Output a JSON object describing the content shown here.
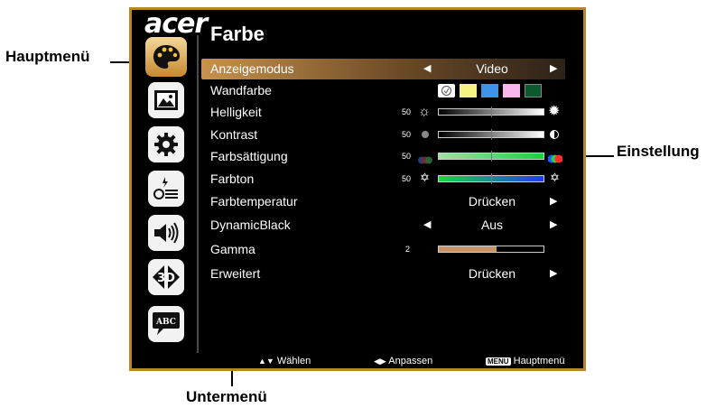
{
  "callouts": {
    "main_menu": "Hauptmenü",
    "setting": "Einstellung",
    "submenu": "Untermenü"
  },
  "brand": "acer",
  "menu": {
    "title": "Farbe",
    "rows": [
      {
        "label": "Anzeigemodus",
        "value": "Video"
      },
      {
        "label": "Wandfarbe"
      },
      {
        "label": "Helligkeit",
        "value": "50",
        "level": 0.5
      },
      {
        "label": "Kontrast",
        "value": "50",
        "level": 0.5
      },
      {
        "label": "Farbsättigung",
        "value": "50",
        "level": 0.5
      },
      {
        "label": "Farbton",
        "value": "50",
        "level": 0.5
      },
      {
        "label": "Farbtemperatur",
        "value": "Drücken"
      },
      {
        "label": "DynamicBlack",
        "value": "Aus"
      },
      {
        "label": "Gamma",
        "value": "2",
        "level": 0.55
      },
      {
        "label": "Erweitert",
        "value": "Drücken"
      }
    ],
    "wall_colors": [
      "#ffffff",
      "#f7f383",
      "#3d94e8",
      "#f7b7ef",
      "#0b5a2e"
    ]
  },
  "sidebar_icons": [
    "palette-icon",
    "image-icon",
    "gear-icon",
    "projector-icon",
    "speaker-icon",
    "3d-icon",
    "language-icon"
  ],
  "footer": {
    "select": "Wählen",
    "adjust": "Anpassen",
    "menu_key": "MENU",
    "main_menu": "Hauptmenü"
  },
  "colors": {
    "frame": "#b8862a",
    "highlight": "#c8924c",
    "gamma_fill": "#c8956a"
  }
}
